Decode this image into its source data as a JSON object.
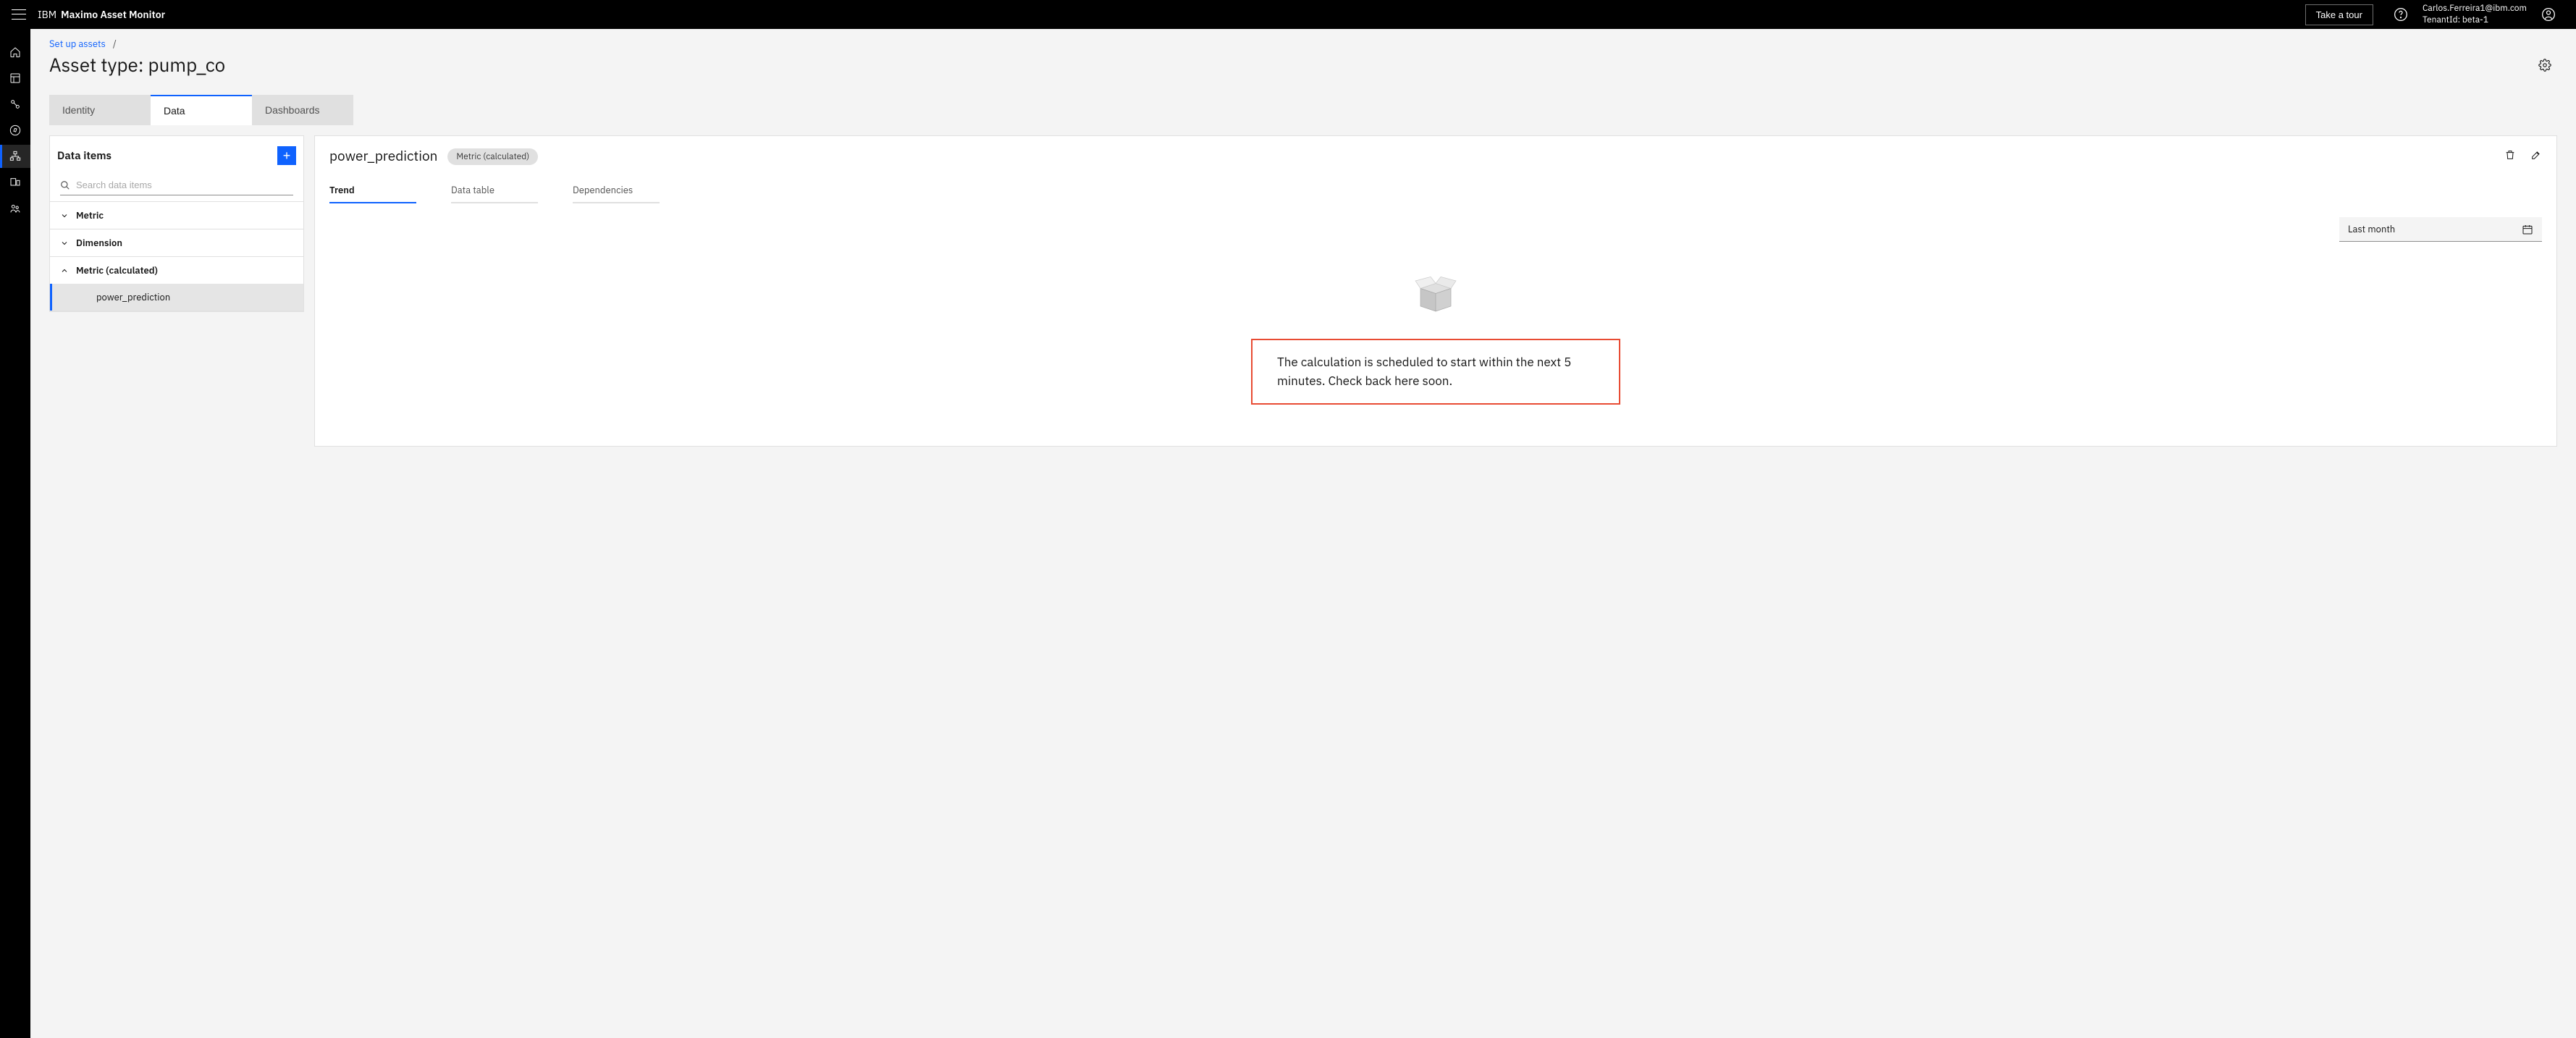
{
  "header": {
    "brand_ibm": "IBM",
    "brand_product": "Maximo Asset Monitor",
    "tour_label": "Take a tour",
    "user_email": "Carlos.Ferreira1@ibm.com",
    "tenant_line": "TenantId: beta-1"
  },
  "breadcrumb": {
    "parent": "Set up assets",
    "separator": "/"
  },
  "page_title": "Asset type: pump_co",
  "tabs": {
    "identity": "Identity",
    "data": "Data",
    "dashboards": "Dashboards"
  },
  "data_items_panel": {
    "title": "Data items",
    "search_placeholder": "Search data items",
    "categories": {
      "metric": "Metric",
      "dimension": "Dimension",
      "metric_calc": "Metric (calculated)"
    },
    "items": {
      "power_prediction": "power_prediction"
    }
  },
  "detail": {
    "title": "power_prediction",
    "badge": "Metric (calculated)",
    "subtabs": {
      "trend": "Trend",
      "data_table": "Data table",
      "dependencies": "Dependencies"
    },
    "date_range": "Last month",
    "empty_message": "The calculation is scheduled to start within the next 5 minutes. Check back here soon."
  }
}
